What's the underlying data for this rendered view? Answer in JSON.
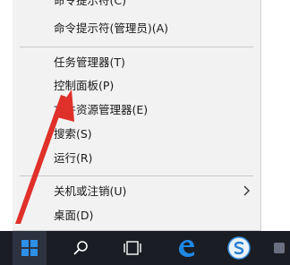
{
  "menu": {
    "items": [
      {
        "label": "命令提示符(C)"
      },
      {
        "label": "命令提示符(管理员)(A)"
      },
      {
        "label": "任务管理器(T)"
      },
      {
        "label": "控制面板(P)"
      },
      {
        "label": "文件资源管理器(E)"
      },
      {
        "label": "搜索(S)"
      },
      {
        "label": "运行(R)"
      },
      {
        "label": "关机或注销(U)"
      },
      {
        "label": "桌面(D)"
      }
    ]
  },
  "taskbar": {
    "icons": [
      "windows-start-icon",
      "search-icon",
      "task-view-icon",
      "edge-icon",
      "sogou-icon"
    ]
  },
  "colors": {
    "menu_bg": "#f2f2f2",
    "taskbar_bg": "#1a1d24",
    "start_accent": "#2d8fe8",
    "arrow": "#e0302a"
  }
}
